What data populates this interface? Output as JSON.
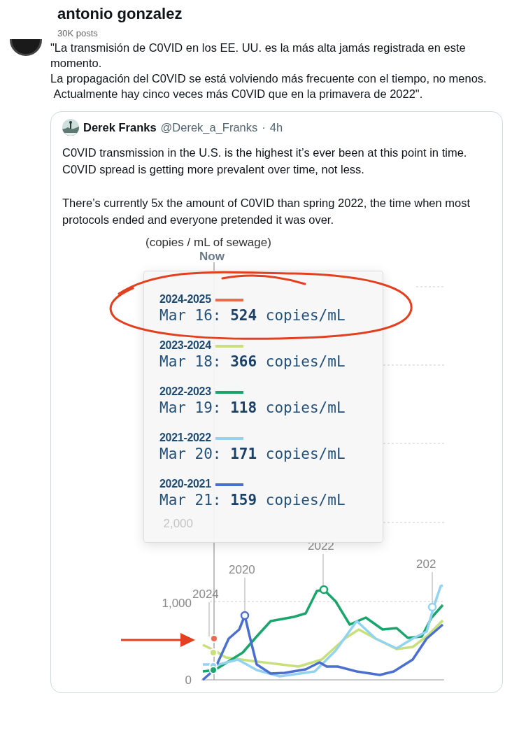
{
  "profile": {
    "name": "antonio gonzalez",
    "posts": "30K posts"
  },
  "post": {
    "text": "\"La transmisión de C0VID en los EE. UU. es la más alta jamás registrada en este momento.\nLa propagación del C0VID se está volviendo más frecuente con el tiempo, no menos.\n Actualmente hay cinco veces más C0VID que en la primavera de 2022\"."
  },
  "quote": {
    "name": "Derek Franks",
    "handle": "@Derek_a_Franks",
    "separator": "·",
    "time": "4h",
    "paragraphs": [
      "C0VID transmission in the U.S. is the highest it’s ever been at this point in time. C0VID spread is getting more prevalent over time, not less.",
      "There’s currently 5x the amount of C0VID than spring 2022, the time when most protocols ended and everyone pretended it was over."
    ],
    "chart": {
      "y_axis_title": "(copies / mL of sewage)",
      "now_label": "Now",
      "y_ticks": [
        "2,000",
        "1,000",
        "0"
      ],
      "year_labels": [
        "2024",
        "2020",
        "2022",
        "202"
      ],
      "tooltip": [
        {
          "season": "2024-2025",
          "color": "#ea6b4f",
          "reading": "Mar 16: **524** copies/mL"
        },
        {
          "season": "2023-2024",
          "color": "#c8e07c",
          "reading": "Mar 18: **366** copies/mL"
        },
        {
          "season": "2022-2023",
          "color": "#1ba56c",
          "reading": "Mar 19: **118** copies/mL"
        },
        {
          "season": "2021-2022",
          "color": "#93d3f2",
          "reading": "Mar 20: **171** copies/mL"
        },
        {
          "season": "2020-2021",
          "color": "#4b6fcf",
          "reading": "Mar 21: **159** copies/mL"
        }
      ]
    }
  }
}
